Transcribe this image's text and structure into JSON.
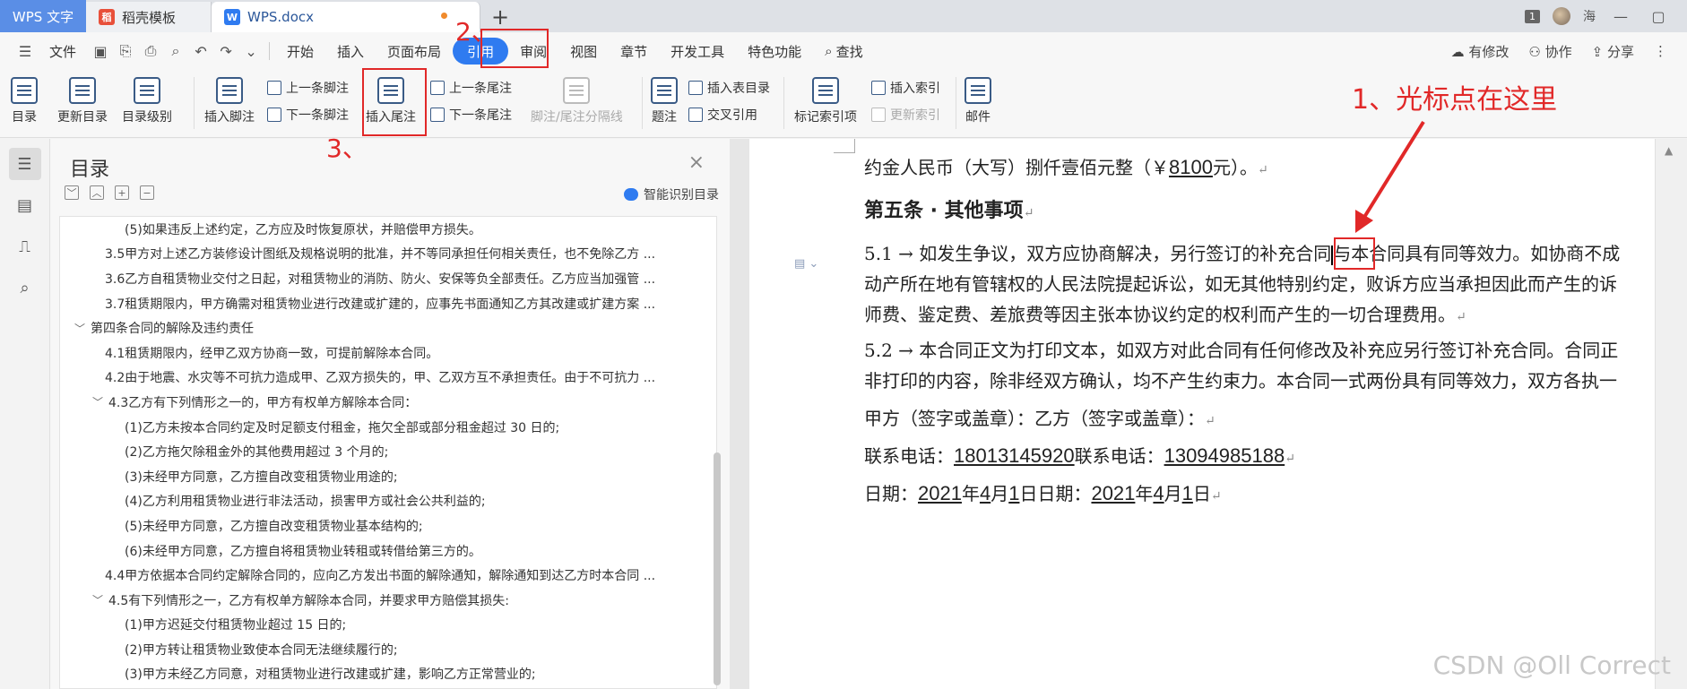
{
  "titlebar": {
    "app_label": "WPS 文字",
    "tabs": [
      {
        "label": "稻壳模板",
        "icon": "daoke-icon"
      },
      {
        "label": "WPS.docx",
        "icon": "wps-doc-icon"
      }
    ],
    "new_tab": "+",
    "count_badge": "1",
    "user_name": "海"
  },
  "menubar": {
    "file_label": "文件",
    "tabs": [
      "开始",
      "插入",
      "页面布局",
      "引用",
      "审阅",
      "视图",
      "章节",
      "开发工具",
      "特色功能"
    ],
    "active_tab": "引用",
    "search_label": "查找",
    "right": [
      "有修改",
      "协作",
      "分享"
    ]
  },
  "ribbon": {
    "toc": "目录",
    "update_toc": "更新目录",
    "toc_level": "目录级别",
    "insert_footnote": "插入脚注",
    "prev_footnote": "上一条脚注",
    "next_footnote": "下一条脚注",
    "insert_endnote": "插入尾注",
    "prev_endnote": "上一条尾注",
    "next_endnote": "下一条尾注",
    "note_separator": "脚注/尾注分隔线",
    "caption": "题注",
    "insert_table_toc": "插入表目录",
    "cross_ref": "交叉引用",
    "mark_index": "标记索引项",
    "insert_index": "插入索引",
    "update_index": "更新索引",
    "mail": "邮件"
  },
  "toc_panel": {
    "title": "目录",
    "smart_label": "智能识别目录",
    "items": [
      {
        "level": "l3",
        "text": "(5)如果违反上述约定，乙方应及时恢复原状，并赔偿甲方损失。"
      },
      {
        "level": "l2",
        "text": "3.5甲方对上述乙方装修设计图纸及规格说明的批准，并不等同承担任何相关责任，也不免除乙方 ..."
      },
      {
        "level": "l2",
        "text": "3.6乙方自租赁物业交付之日起，对租赁物业的消防、防火、安保等负全部责任。乙方应当加强管 ..."
      },
      {
        "level": "l2",
        "text": "3.7租赁期限内，甲方确需对租赁物业进行改建或扩建的，应事先书面通知乙方其改建或扩建方案 ..."
      },
      {
        "level": "l1",
        "toggle": "﹀",
        "text": "第四条合同的解除及违约责任"
      },
      {
        "level": "l2",
        "text": "4.1租赁期限内，经甲乙双方协商一致，可提前解除本合同。"
      },
      {
        "level": "l2",
        "text": "4.2由于地震、水灾等不可抗力造成甲、乙双方损失的，甲、乙双方互不承担责任。由于不可抗力 ..."
      },
      {
        "level": "l2c",
        "toggle": "﹀",
        "text": "4.3乙方有下列情形之一的，甲方有权单方解除本合同："
      },
      {
        "level": "l3",
        "text": "(1)乙方未按本合同约定及时足额支付租金，拖欠全部或部分租金超过 30 日的;"
      },
      {
        "level": "l3",
        "text": "(2)乙方拖欠除租金外的其他费用超过 3 个月的;"
      },
      {
        "level": "l3",
        "text": "(3)未经甲方同意，乙方擅自改变租赁物业用途的;"
      },
      {
        "level": "l3",
        "text": "(4)乙方利用租赁物业进行非法活动，损害甲方或社会公共利益的;"
      },
      {
        "level": "l3",
        "text": "(5)未经甲方同意，乙方擅自改变租赁物业基本结构的;"
      },
      {
        "level": "l3",
        "text": "(6)未经甲方同意，乙方擅自将租赁物业转租或转借给第三方的。"
      },
      {
        "level": "l2",
        "text": "4.4甲方依据本合同约定解除合同的，应向乙方发出书面的解除通知，解除通知到达乙方时本合同 ..."
      },
      {
        "level": "l2c",
        "toggle": "﹀",
        "text": "4.5有下列情形之一，乙方有权单方解除本合同，并要求甲方赔偿其损失:"
      },
      {
        "level": "l3",
        "text": "(1)甲方迟延交付租赁物业超过 15 日的;"
      },
      {
        "level": "l3",
        "text": "(2)甲方转让租赁物业致使本合同无法继续履行的;"
      },
      {
        "level": "l3",
        "text": "(3)甲方未经乙方同意，对租赁物业进行改建或扩建，影响乙方正常营业的;"
      }
    ]
  },
  "document": {
    "line1_pre": "约金人民币（大写）捌仟壹佰元整（￥",
    "line1_amount": "8100",
    "line1_post": "元）。",
    "heading": "第五条 · 其他事项",
    "p1_l1_a": "5.1 → 如发生争议，双方应协商解决，另行签订的补充合",
    "p1_l1_b": "同",
    "p1_l1_c": "与本合同具有同等效力。如协商不成",
    "p1_l2": "动产所在地有管辖权的人民法院提起诉讼，如无其他特别约定，败诉方应当承担因此而产生的诉",
    "p1_l3": "师费、鉴定费、差旅费等因主张本协议约定的权利而产生的一切合理费用。",
    "p2_l1": "5.2 → 本合同正文为打印文本，如双方对此合同有任何修改及补充应另行签订补充合同。合同正",
    "p2_l2": "非打印的内容，除非经双方确认，均不产生约束力。本合同一式两份具有同等效力，双方各执一",
    "sign": "甲方（签字或盖章）：乙方（签字或盖章）：",
    "phone_label": "联系电话：",
    "phone1": "18013145920",
    "phone2": "13094985188",
    "date_label": "日期：",
    "year": "2021",
    "year_unit": "年",
    "month": "4",
    "month_unit": "月",
    "day": "1",
    "day_unit": "日"
  },
  "annotations": {
    "step1": "1、光标点在这里",
    "step2": "2、",
    "step3": "3、",
    "color": "#e12828"
  },
  "watermark": "CSDN @Oll Correct"
}
